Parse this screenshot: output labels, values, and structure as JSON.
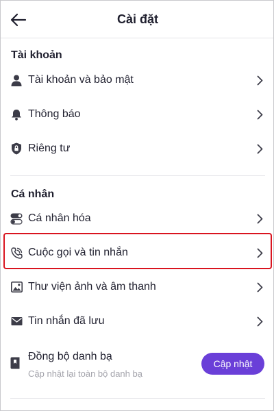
{
  "header": {
    "title": "Cài đặt",
    "back_icon": "arrow-left-icon"
  },
  "sections": {
    "account": {
      "title": "Tài khoản",
      "items": [
        {
          "label": "Tài khoản và bảo mật",
          "icon": "user-icon"
        },
        {
          "label": "Thông báo",
          "icon": "bell-icon"
        },
        {
          "label": "Riêng tư",
          "icon": "shield-lock-icon"
        }
      ]
    },
    "personal": {
      "title": "Cá nhân",
      "items": [
        {
          "label": "Cá nhân hóa",
          "icon": "toggle-icon"
        },
        {
          "label": "Cuộc gọi và tin nhắn",
          "icon": "phone-call-icon",
          "highlighted": true
        },
        {
          "label": "Thư viện ảnh và âm thanh",
          "icon": "image-icon"
        },
        {
          "label": "Tin nhắn đã lưu",
          "icon": "envelope-icon"
        }
      ],
      "sync": {
        "label": "Đồng bộ danh bạ",
        "sublabel": "Cập nhật lại toàn bộ danh bạ",
        "icon": "contacts-book-icon",
        "button_label": "Cập nhật"
      }
    }
  },
  "colors": {
    "accent": "#6a3fd8",
    "highlight_border": "#d9141f",
    "text": "#1f1f2e",
    "icon": "#3c3c48",
    "subtext": "#a3a3ab"
  }
}
